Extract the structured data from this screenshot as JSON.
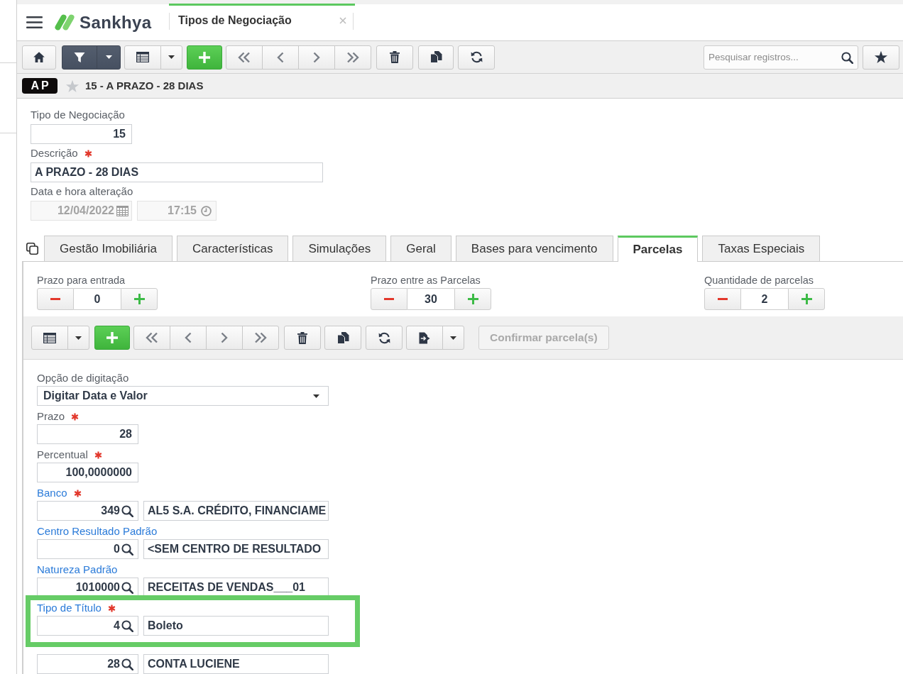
{
  "app": {
    "name": "Sankhya",
    "open_tabs": [
      {
        "label": "Tipos de Negociação",
        "selected": true
      }
    ]
  },
  "toolbar": {
    "filter_active": true,
    "search": {
      "placeholder": "Pesquisar registros..."
    }
  },
  "record": {
    "badge": "AP",
    "title": "15 - A PRAZO - 28 DIAS",
    "favorite": false
  },
  "form": {
    "fields": [
      {
        "kind": "number",
        "label": "Tipo de Negociação",
        "value": "15",
        "required": false,
        "disabled": false
      },
      {
        "kind": "text",
        "label": "Descrição",
        "value": "A PRAZO - 28 DIAS",
        "required": true,
        "disabled": false
      },
      {
        "kind": "datetime",
        "label": "Data e hora alteração",
        "date": "12/04/2022",
        "time": "17:15",
        "required": false,
        "disabled": true
      }
    ]
  },
  "tabs": [
    {
      "label": "Gestão Imobiliária",
      "selected": false
    },
    {
      "label": "Características",
      "selected": false
    },
    {
      "label": "Simulações",
      "selected": false
    },
    {
      "label": "Geral",
      "selected": false
    },
    {
      "label": "Bases para vencimento",
      "selected": false
    },
    {
      "label": "Parcelas",
      "selected": true
    },
    {
      "label": "Taxas Especiais",
      "selected": false
    }
  ],
  "parcelas": {
    "steppers": [
      {
        "label": "Prazo para entrada",
        "value": "0"
      },
      {
        "label": "Prazo entre as Parcelas",
        "value": "30"
      },
      {
        "label": "Quantidade de parcelas",
        "value": "2"
      }
    ],
    "toolbar": {
      "confirm_button": {
        "label": "Confirmar parcela(s)",
        "disabled": true
      }
    },
    "fields": [
      {
        "kind": "select",
        "label": "Opção de digitação",
        "value": "Digitar Data e Valor",
        "required": false,
        "highlighted": false
      },
      {
        "kind": "number",
        "label": "Prazo",
        "value": "28",
        "required": true,
        "highlighted": false
      },
      {
        "kind": "number",
        "label": "Percentual",
        "value": "100,0000000",
        "required": true,
        "highlighted": false
      },
      {
        "kind": "lookup",
        "label": "Banco",
        "code": "349",
        "description": "AL5 S.A. CRÉDITO, FINANCIAME",
        "required": true,
        "highlighted": false
      },
      {
        "kind": "lookup",
        "label": "Centro Resultado Padrão",
        "code": "0",
        "description": "<SEM CENTRO DE RESULTADO",
        "required": false,
        "highlighted": false
      },
      {
        "kind": "lookup",
        "label": "Natureza Padrão",
        "code": "1010000",
        "description": "RECEITAS DE VENDAS___01",
        "required": false,
        "highlighted": false
      },
      {
        "kind": "lookup",
        "label": "Tipo de Título",
        "code": "4",
        "description": "Boleto",
        "required": true,
        "highlighted": true
      },
      {
        "kind": "lookup",
        "code": "28",
        "description": "CONTA LUCIENE",
        "required": false,
        "highlighted": false
      }
    ]
  }
}
